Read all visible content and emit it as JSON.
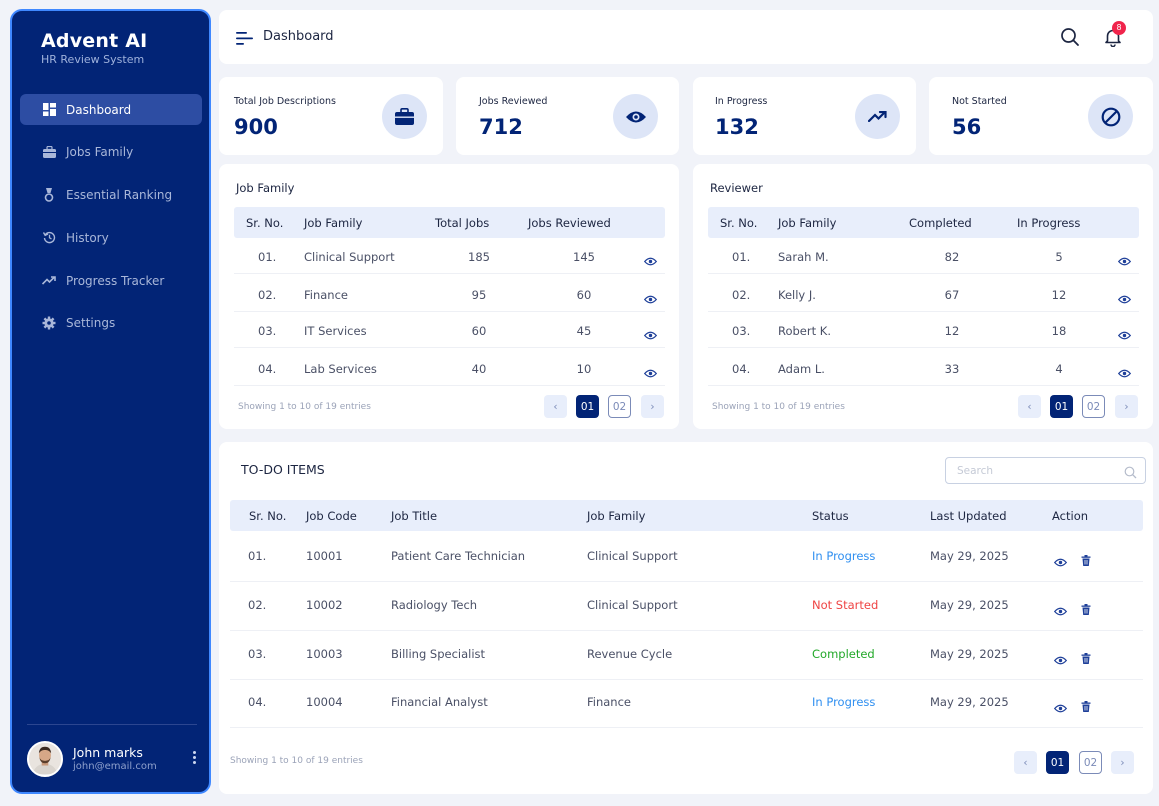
{
  "brand": {
    "title": "Advent AI",
    "subtitle": "HR Review System"
  },
  "nav": [
    {
      "label": "Dashboard",
      "icon": "grid-icon",
      "active": true
    },
    {
      "label": "Jobs Family",
      "icon": "briefcase-icon"
    },
    {
      "label": "Essential Ranking",
      "icon": "medal-icon"
    },
    {
      "label": "History",
      "icon": "history-icon"
    },
    {
      "label": "Progress Tracker",
      "icon": "trending-up-icon"
    },
    {
      "label": "Settings",
      "icon": "gear-icon"
    }
  ],
  "user": {
    "name": "John marks",
    "email": "john@email.com"
  },
  "header": {
    "title": "Dashboard",
    "notification_count": "8"
  },
  "stats": [
    {
      "label": "Total Job Descriptions",
      "value": "900",
      "icon": "briefcase-icon"
    },
    {
      "label": "Jobs Reviewed",
      "value": "712",
      "icon": "eye-icon"
    },
    {
      "label": "In Progress",
      "value": "132",
      "icon": "trending-up-icon"
    },
    {
      "label": "Not Started",
      "value": "56",
      "icon": "ban-icon"
    }
  ],
  "job_family": {
    "title": "Job Family",
    "columns": [
      "Sr. No.",
      "Job Family",
      "Total Jobs",
      "Jobs Reviewed"
    ],
    "rows": [
      [
        "01.",
        "Clinical Support",
        "185",
        "145"
      ],
      [
        "02.",
        "Finance",
        "95",
        "60"
      ],
      [
        "03.",
        "IT Services",
        "60",
        "45"
      ],
      [
        "04.",
        "Lab Services",
        "40",
        "10"
      ]
    ],
    "showing": "Showing 1 to 10 of 19 entries",
    "pages": [
      "01",
      "02"
    ]
  },
  "reviewer": {
    "title": "Reviewer",
    "columns": [
      "Sr. No.",
      "Job Family",
      "Completed",
      "In Progress"
    ],
    "rows": [
      [
        "01.",
        "Sarah M.",
        "82",
        "5"
      ],
      [
        "02.",
        "Kelly J.",
        "67",
        "12"
      ],
      [
        "03.",
        "Robert K.",
        "12",
        "18"
      ],
      [
        "04.",
        "Adam L.",
        "33",
        "4"
      ]
    ],
    "showing": "Showing 1 to 10 of 19 entries",
    "pages": [
      "01",
      "02"
    ]
  },
  "todo": {
    "title": "TO-DO ITEMS",
    "search_placeholder": "Search",
    "columns": [
      "Sr. No.",
      "Job Code",
      "Job Title",
      "Job Family",
      "Status",
      "Last Updated",
      "Action"
    ],
    "rows": [
      [
        "01.",
        "10001",
        "Patient Care Technician",
        "Clinical Support",
        "In Progress",
        "May 29, 2025"
      ],
      [
        "02.",
        "10002",
        "Radiology Tech",
        "Clinical Support",
        "Not Started",
        "May 29, 2025"
      ],
      [
        "03.",
        "10003",
        "Billing Specialist",
        "Revenue Cycle",
        "Completed",
        "May 29, 2025"
      ],
      [
        "04.",
        "10004",
        "Financial Analyst",
        "Finance",
        "In Progress",
        "May 29, 2025"
      ]
    ],
    "status_colors": {
      "In Progress": "#2f8ff0",
      "Not Started": "#ef4444",
      "Completed": "#22a829"
    },
    "showing": "Showing 1 to 10 of 19 entries",
    "pages": [
      "01",
      "02"
    ]
  }
}
